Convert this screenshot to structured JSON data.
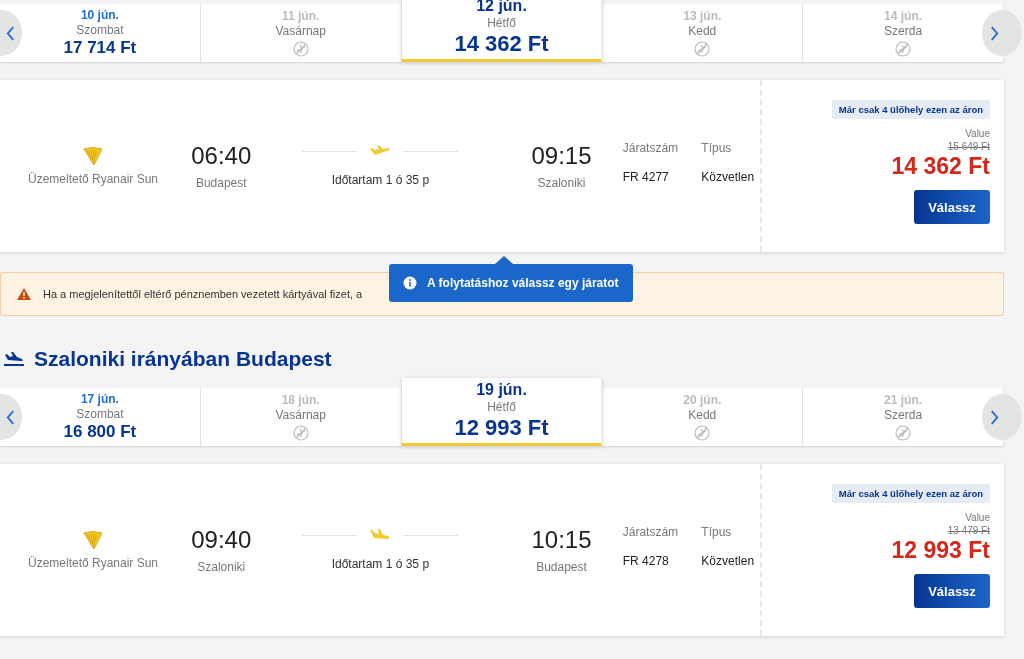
{
  "sections": [
    {
      "kind": "outbound",
      "dates": [
        {
          "date": "10 jún.",
          "day": "Szombat",
          "available": true,
          "price": "17 714 Ft",
          "selected": false
        },
        {
          "date": "11 jún.",
          "day": "Vasárnap",
          "available": false,
          "selected": false
        },
        {
          "date": "12 jún.",
          "day": "Hétfő",
          "available": true,
          "price": "14 362 Ft",
          "selected": true
        },
        {
          "date": "13 jún.",
          "day": "Kedd",
          "available": false,
          "selected": false
        },
        {
          "date": "14 jún.",
          "day": "Szerda",
          "available": false,
          "selected": false
        }
      ],
      "flight": {
        "operator": "Üzemeltető Ryanair Sun",
        "depart_time": "06:40",
        "depart_city": "Budapest",
        "duration": "Időtartam 1 ó 35 p",
        "arrive_time": "09:15",
        "arrive_city": "Szaloniki",
        "flight_no_label": "Járatszám",
        "flight_no": "FR 4277",
        "type_label": "Típus",
        "type": "Közvetlen",
        "badge": "Már csak 4 ülőhely ezen az áron",
        "fare": "Value",
        "old_price": "15 649 Ft",
        "price": "14 362 Ft",
        "button": "Válassz"
      },
      "tooltip": "A folytatáshoz válassz egy járatot",
      "warning": "Ha a megjelenítettől eltérő pénznemben vezetett kártyával fizet, a"
    },
    {
      "kind": "inbound",
      "heading": "Szaloniki irányában Budapest",
      "dates": [
        {
          "date": "17 jún.",
          "day": "Szombat",
          "available": true,
          "price": "16 800 Ft",
          "selected": false
        },
        {
          "date": "18 jún.",
          "day": "Vasárnap",
          "available": false,
          "selected": false
        },
        {
          "date": "19 jún.",
          "day": "Hétfő",
          "available": true,
          "price": "12 993 Ft",
          "selected": true
        },
        {
          "date": "20 jún.",
          "day": "Kedd",
          "available": false,
          "selected": false
        },
        {
          "date": "21 jún.",
          "day": "Szerda",
          "available": false,
          "selected": false
        }
      ],
      "flight": {
        "operator": "Üzemeltető Ryanair Sun",
        "depart_time": "09:40",
        "depart_city": "Szaloniki",
        "duration": "Időtartam 1 ó 35 p",
        "arrive_time": "10:15",
        "arrive_city": "Budapest",
        "flight_no_label": "Járatszám",
        "flight_no": "FR 4278",
        "type_label": "Típus",
        "type": "Közvetlen",
        "badge": "Már csak 4 ülőhely ezen az áron",
        "fare": "Value",
        "old_price": "13 479 Ft",
        "price": "12 993 Ft",
        "button": "Válassz"
      }
    }
  ]
}
